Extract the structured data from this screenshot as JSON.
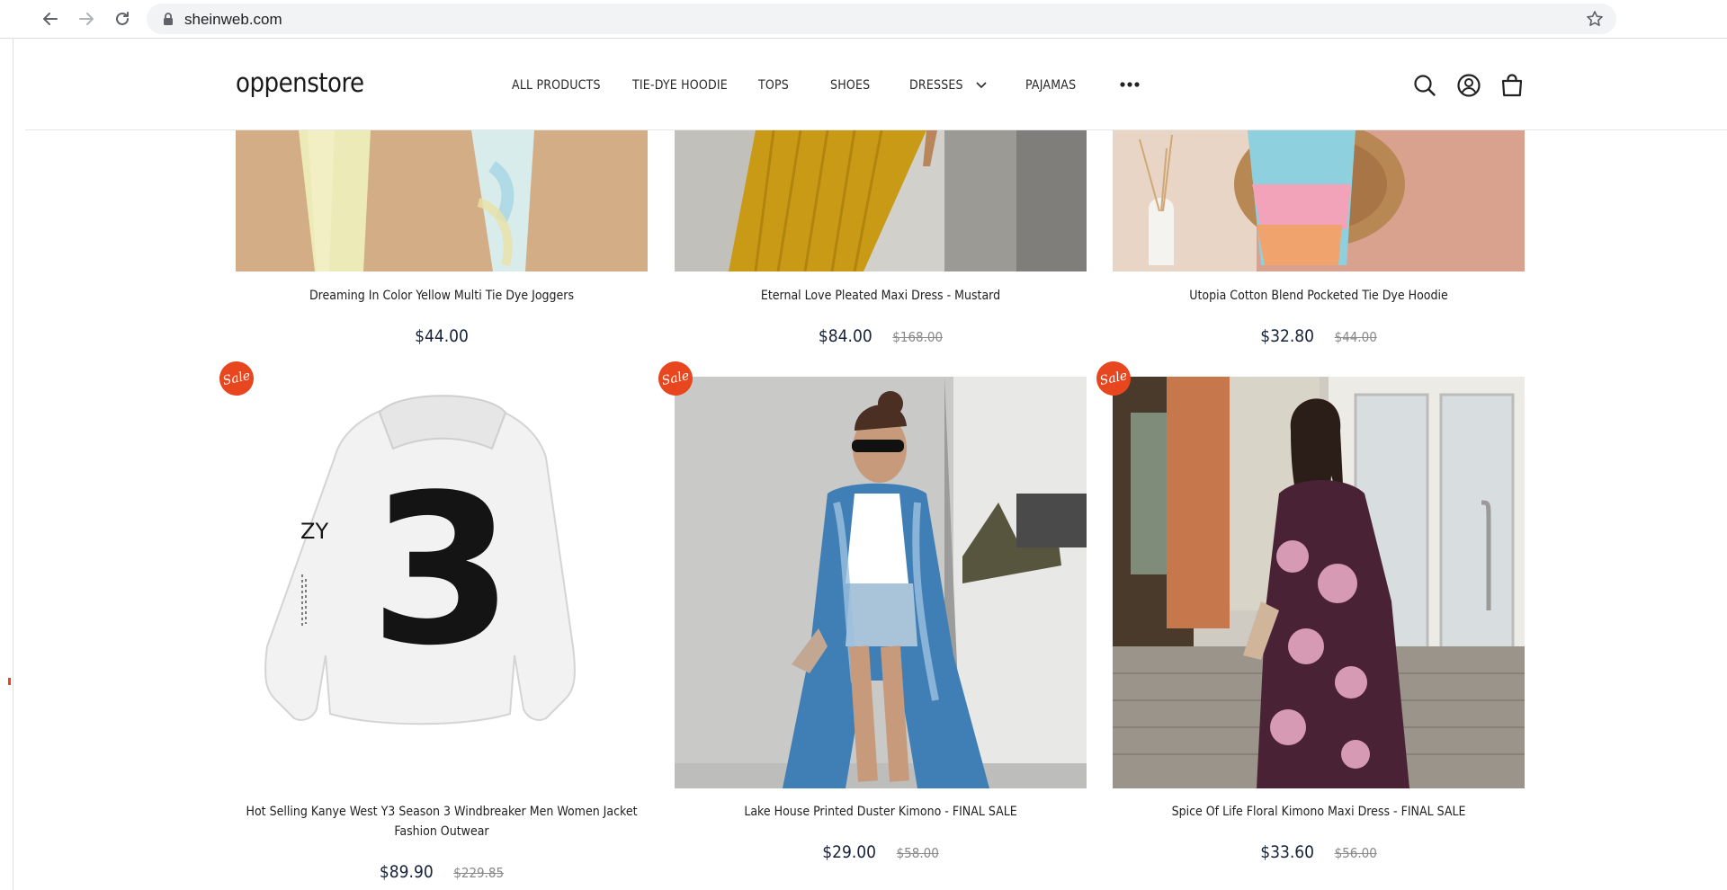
{
  "browser": {
    "url": "sheinweb.com",
    "icons": [
      "back-arrow-icon",
      "forward-arrow-icon",
      "reload-icon",
      "lock-icon",
      "star-icon"
    ]
  },
  "header": {
    "logo": "oppenstore",
    "nav": [
      {
        "label": "ALL PRODUCTS"
      },
      {
        "label": "TIE-DYE HOODIE"
      },
      {
        "label": "TOPS"
      },
      {
        "label": "SHOES"
      },
      {
        "label": "DRESSES",
        "has_dropdown": true
      },
      {
        "label": "PAJAMAS"
      }
    ],
    "icons": [
      "more-dots-icon",
      "search-icon",
      "account-icon",
      "cart-icon"
    ]
  },
  "badge_label": "Sale",
  "products": [
    {
      "title": "Dreaming In Color Yellow Multi Tie Dye Joggers",
      "price": "$44.00",
      "compare_price": "",
      "sale": false
    },
    {
      "title": "Eternal Love Pleated Maxi Dress - Mustard",
      "price": "$84.00",
      "compare_price": "$168.00",
      "sale": true
    },
    {
      "title": "Utopia Cotton Blend Pocketed Tie Dye Hoodie",
      "price": "$32.80",
      "compare_price": "$44.00",
      "sale": true
    },
    {
      "title": "Hot Selling Kanye West Y3 Season 3 Windbreaker Men Women Jacket Fashion Outwear",
      "price": "$89.90",
      "compare_price": "$229.85",
      "sale": true
    },
    {
      "title": "Lake House Printed Duster Kimono - FINAL SALE",
      "price": "$29.00",
      "compare_price": "$58.00",
      "sale": true
    },
    {
      "title": "Spice Of Life Floral Kimono Maxi Dress - FINAL SALE",
      "price": "$33.60",
      "compare_price": "$56.00",
      "sale": true
    }
  ],
  "jacket_print": {
    "number": "3",
    "text": "ZY"
  },
  "colors": {
    "sale_badge": "#e8461f",
    "price": "#17233a",
    "compare_price": "#8a8a8a"
  }
}
